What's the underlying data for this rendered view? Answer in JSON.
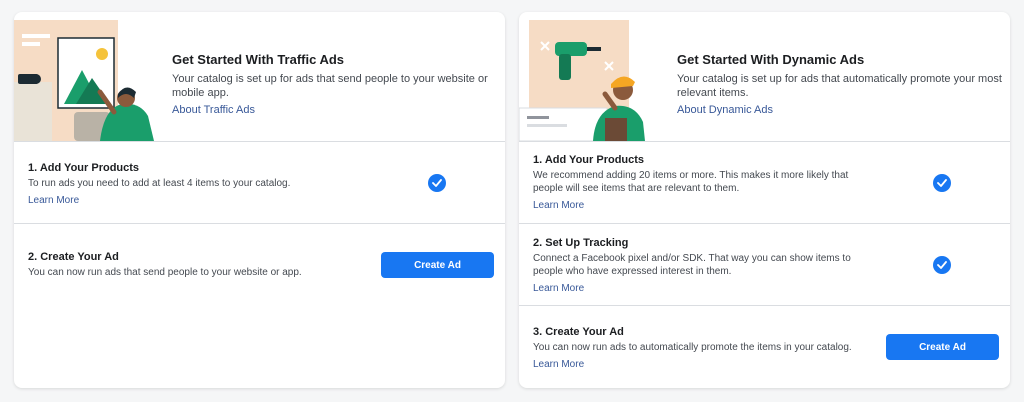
{
  "traffic": {
    "hero_title": "Get Started With Traffic Ads",
    "hero_desc": "Your catalog is set up for ads that send people to your website or mobile app.",
    "hero_link": "About Traffic Ads",
    "steps": [
      {
        "title": "1. Add Your Products",
        "desc": "To run ads you need to add at least 4 items to your catalog.",
        "link": "Learn More",
        "status": "complete"
      },
      {
        "title": "2. Create Your Ad",
        "desc": "You can now run ads that send people to your website or app.",
        "button": "Create Ad"
      }
    ]
  },
  "dynamic": {
    "hero_title": "Get Started With Dynamic Ads",
    "hero_desc": "Your catalog is set up for ads that automatically promote your most relevant items.",
    "hero_link": "About Dynamic Ads",
    "steps": [
      {
        "title": "1. Add Your Products",
        "desc": "We recommend adding 20 items or more. This makes it more likely that people will see items that are relevant to them.",
        "link": "Learn More",
        "status": "complete"
      },
      {
        "title": "2. Set Up Tracking",
        "desc": "Connect a Facebook pixel and/or SDK. That way you can show items to people who have expressed interest in them.",
        "link": "Learn More",
        "status": "complete"
      },
      {
        "title": "3. Create Your Ad",
        "desc": "You can now run ads to automatically promote the items in your catalog.",
        "link": "Learn More",
        "button": "Create Ad"
      }
    ]
  },
  "colors": {
    "accent": "#1877f2",
    "link": "#385898",
    "divider": "#dadde1"
  },
  "icons": {
    "check": "check-circle-icon"
  }
}
